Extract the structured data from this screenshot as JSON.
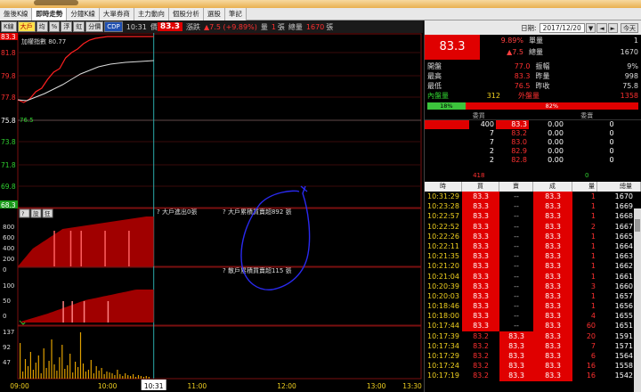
{
  "window": {
    "tabs": [
      "盤後K線",
      "即時走勢",
      "分鐘K線",
      "大單券商",
      "主力動向",
      "個股分析",
      "選股",
      "筆記"
    ],
    "active_tab": 1
  },
  "toolbar": {
    "buttons": [
      "K線",
      "大戶",
      "均",
      "%",
      "浮",
      "虹",
      "分價",
      "CDP"
    ],
    "time": "10:31",
    "price_label": "價",
    "price_value": "83.3",
    "change_label": "漲跌",
    "change_value": "▲7.5 (+9.89%)",
    "volume_label": "量",
    "volume_value": "1",
    "volume_unit": "張",
    "total_label": "總量",
    "total_value": "1670",
    "total_unit": "張"
  },
  "chart": {
    "weighted_label": "加權指數 80.77",
    "price_ticks": [
      "83.3",
      "81.8",
      "79.8",
      "77.8",
      "75.8",
      "73.8",
      "71.8",
      "69.8",
      "68.3"
    ],
    "ref_price": "76.5",
    "panel2_buttons": [
      "?",
      "設",
      "狂"
    ],
    "panel2_ticks": [
      "800",
      "600",
      "400",
      "200",
      "0"
    ],
    "panel2_notes": [
      "?  大戶進出0張",
      "?  大戶累積買賣超892 張"
    ],
    "panel3_ticks": [
      "100",
      "50",
      "0"
    ],
    "panel3_notes": [
      "?  散戶累積買賣超115 張"
    ],
    "panel4_ticks": [
      "137",
      "92",
      "47"
    ],
    "time_ticks": [
      "09:00",
      "10:00",
      "10:31",
      "11:00",
      "12:00",
      "13:00",
      "13:30"
    ]
  },
  "right": {
    "date_label": "日期:",
    "date_value": "2017/12/20",
    "date_buttons": [
      "▼",
      "◄",
      "►"
    ],
    "today": "今天",
    "big_price": "83.3",
    "pct": "9.89%",
    "change": "▲7.5",
    "vol_labels": [
      "單量",
      "總量"
    ],
    "vol_values": [
      "1",
      "1670"
    ],
    "stats": [
      {
        "k": "開盤",
        "v": "77.0"
      },
      {
        "k": "振幅",
        "v": "9%"
      },
      {
        "k": "最高",
        "v": "83.3"
      },
      {
        "k": "昨量",
        "v": "998"
      },
      {
        "k": "最低",
        "v": "76.5"
      },
      {
        "k": "昨收",
        "v": "75.8"
      }
    ],
    "inner_label": "內盤量",
    "inner_value": "312",
    "outer_label": "外盤量",
    "outer_value": "1358",
    "inner_pct": "18%",
    "outer_pct": "82%",
    "ob_headers": [
      "委買",
      "委賣"
    ],
    "orderbook": [
      {
        "bv": "400",
        "bp": "83.3",
        "ap": "0.00",
        "av": "0"
      },
      {
        "bv": "7",
        "bp": "83.2",
        "ap": "0.00",
        "av": "0"
      },
      {
        "bv": "7",
        "bp": "83.0",
        "ap": "0.00",
        "av": "0"
      },
      {
        "bv": "2",
        "bp": "82.9",
        "ap": "0.00",
        "av": "0"
      },
      {
        "bv": "2",
        "bp": "82.8",
        "ap": "0.00",
        "av": "0"
      }
    ],
    "ob_sum": [
      "418",
      "0"
    ],
    "tt_headers": [
      "時",
      "買",
      "賣",
      "成",
      "量",
      "總量"
    ],
    "trades": [
      [
        "10:31:29",
        "83.3",
        "--",
        "83.3",
        "1",
        "1670"
      ],
      [
        "10:23:28",
        "83.3",
        "--",
        "83.3",
        "1",
        "1669"
      ],
      [
        "10:22:57",
        "83.3",
        "--",
        "83.3",
        "1",
        "1668"
      ],
      [
        "10:22:52",
        "83.3",
        "--",
        "83.3",
        "2",
        "1667"
      ],
      [
        "10:22:26",
        "83.3",
        "--",
        "83.3",
        "1",
        "1665"
      ],
      [
        "10:22:11",
        "83.3",
        "--",
        "83.3",
        "1",
        "1664"
      ],
      [
        "10:21:35",
        "83.3",
        "--",
        "83.3",
        "1",
        "1663"
      ],
      [
        "10:21:20",
        "83.3",
        "--",
        "83.3",
        "1",
        "1662"
      ],
      [
        "10:21:04",
        "83.3",
        "--",
        "83.3",
        "1",
        "1661"
      ],
      [
        "10:20:39",
        "83.3",
        "--",
        "83.3",
        "3",
        "1660"
      ],
      [
        "10:20:03",
        "83.3",
        "--",
        "83.3",
        "1",
        "1657"
      ],
      [
        "10:18:46",
        "83.3",
        "--",
        "83.3",
        "1",
        "1656"
      ],
      [
        "10:18:00",
        "83.3",
        "--",
        "83.3",
        "4",
        "1655"
      ],
      [
        "10:17:44",
        "83.3",
        "--",
        "83.3",
        "60",
        "1651"
      ],
      [
        "10:17:39",
        "83.2",
        "83.3",
        "83.3",
        "20",
        "1591"
      ],
      [
        "10:17:34",
        "83.2",
        "83.3",
        "83.3",
        "7",
        "1571"
      ],
      [
        "10:17:29",
        "83.2",
        "83.3",
        "83.3",
        "6",
        "1564"
      ],
      [
        "10:17:24",
        "83.2",
        "83.3",
        "83.3",
        "16",
        "1558"
      ],
      [
        "10:17:19",
        "83.2",
        "83.3",
        "83.3",
        "16",
        "1542"
      ]
    ]
  }
}
